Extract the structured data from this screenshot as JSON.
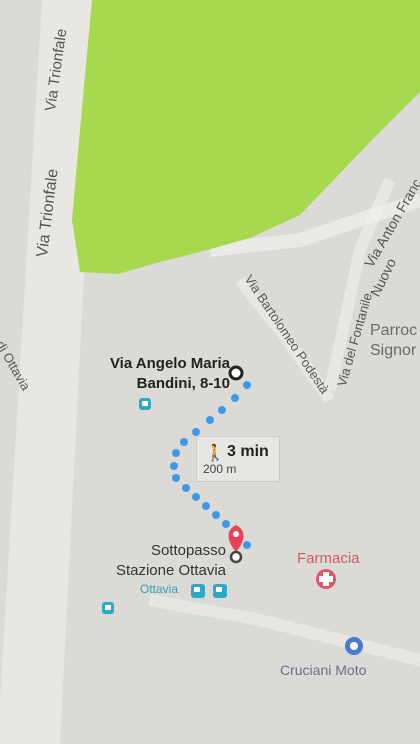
{
  "map": {
    "roads": {
      "via_trionfale_1": "Via Trionfale",
      "via_trionfale_2": "Via Trionfale",
      "via_anton_francesco": "Via Anton Franc",
      "nuovo": "Nuovo",
      "via_bartolomeo_podesta": "Via Bartolomeo Podestà",
      "via_del_fontanile": "Via del Fontanile",
      "di_ottavia": "di Ottavia"
    },
    "places": {
      "parrocchia_1": "Parroc",
      "parrocchia_2": "Signor",
      "farmacia": "Farmacia",
      "cruciani_moto": "Cruciani Moto",
      "ottavia_station": "Ottavia"
    },
    "route": {
      "origin_line1": "Via Angelo Maria",
      "origin_line2": "Bandini, 8-10",
      "destination_line1": "Sottopasso",
      "destination_line2": "Stazione Ottavia",
      "walk_icon": "🚶",
      "duration": "3 min",
      "distance": "200 m"
    }
  },
  "colors": {
    "park": "#a6d94e",
    "background": "#dcdad6",
    "route_dots": "#3e9ae8",
    "pin": "#e8415a",
    "farmacia": "#e05868",
    "transit": "#2ea8c8"
  }
}
